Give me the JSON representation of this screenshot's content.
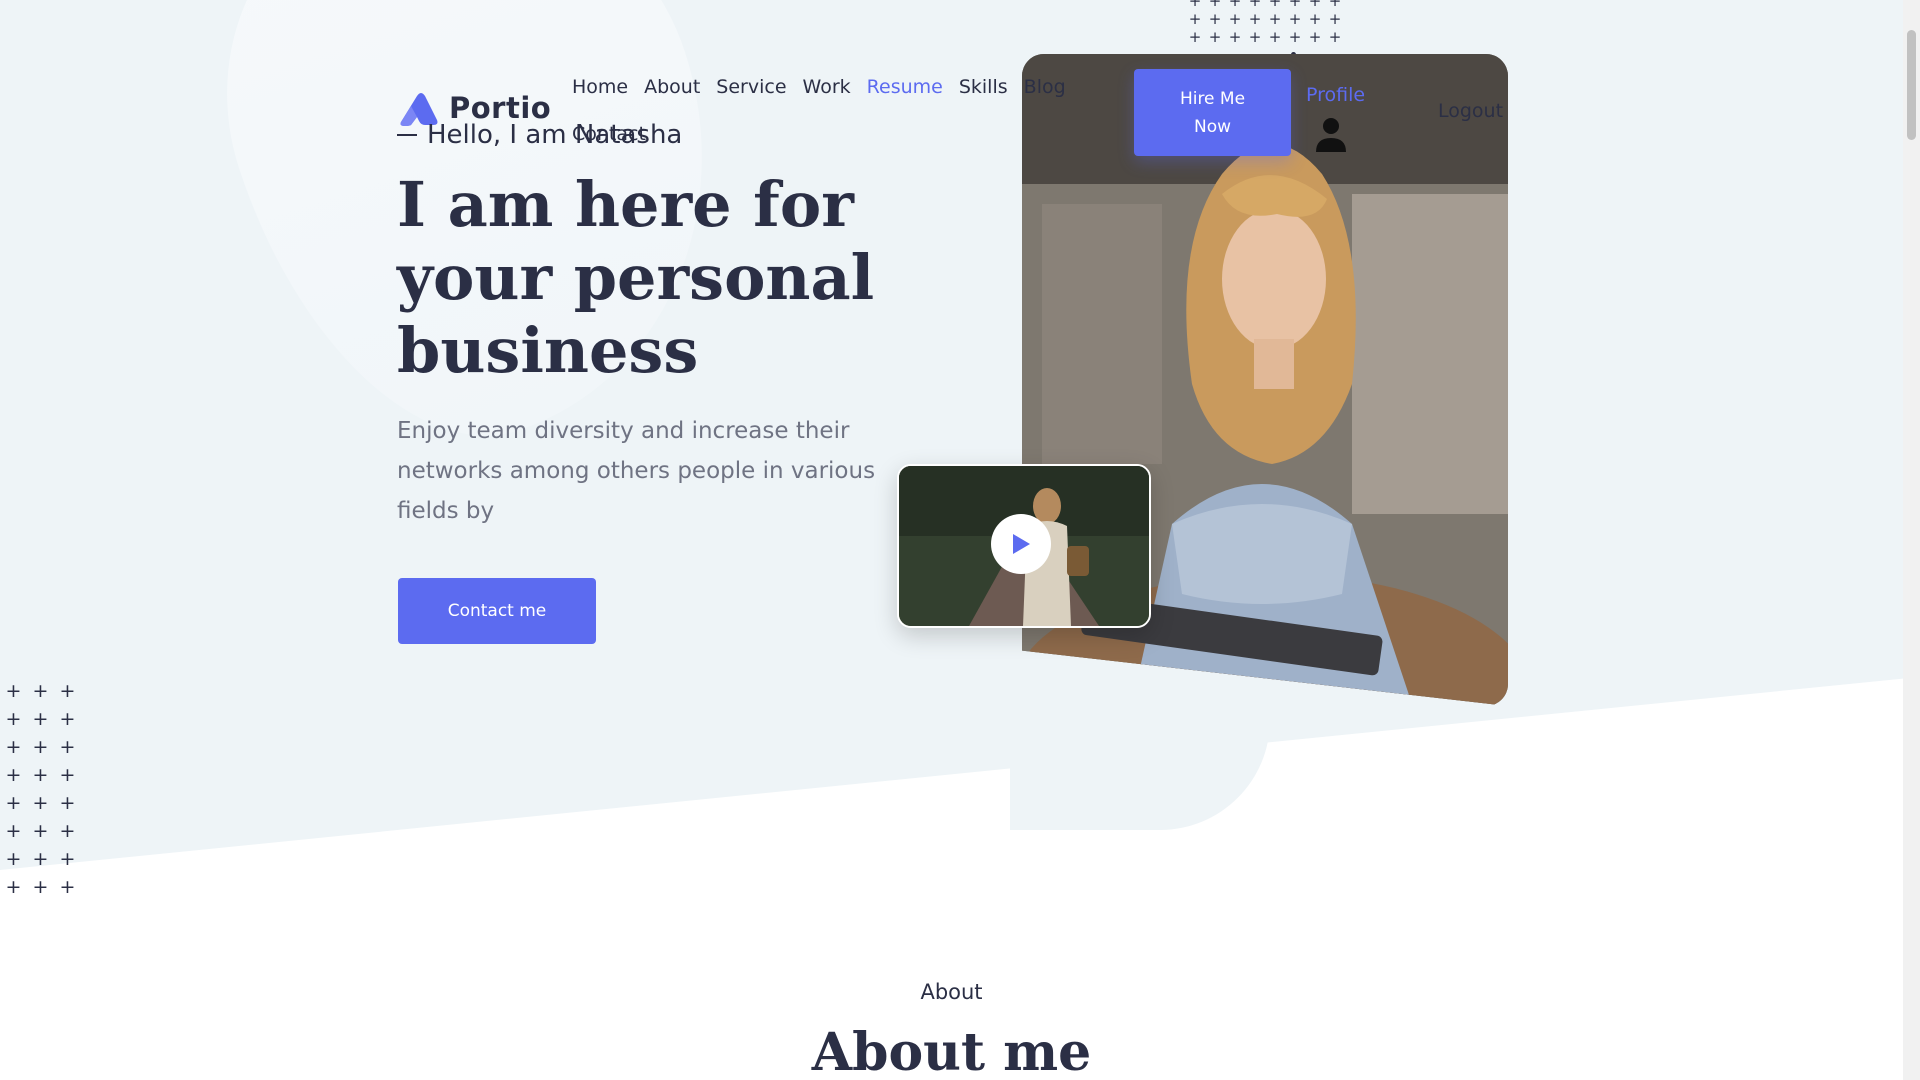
{
  "brand": {
    "name": "Portio",
    "accent": "#5c6bf0",
    "dark": "#2b2f45"
  },
  "nav": {
    "items": [
      {
        "label": "Home",
        "active": false
      },
      {
        "label": "About",
        "active": false
      },
      {
        "label": "Service",
        "active": false
      },
      {
        "label": "Work",
        "active": false
      },
      {
        "label": "Resume",
        "active": true
      },
      {
        "label": "Skills",
        "active": false
      },
      {
        "label": "Blog",
        "active": false
      }
    ],
    "contact": "Contact",
    "hire_button": "Hire Me Now",
    "profile": "Profile",
    "profile_icon": "person-icon",
    "logout": "Logout"
  },
  "hero": {
    "greeting": "Hello, I am Natasha",
    "headline": "I am here for your personal business",
    "description": "Enjoy team diversity and increase their networks among others people in various fields by",
    "cta": "Contact me",
    "video_icon": "play-icon"
  },
  "about": {
    "kicker": "About",
    "title": "About me"
  }
}
